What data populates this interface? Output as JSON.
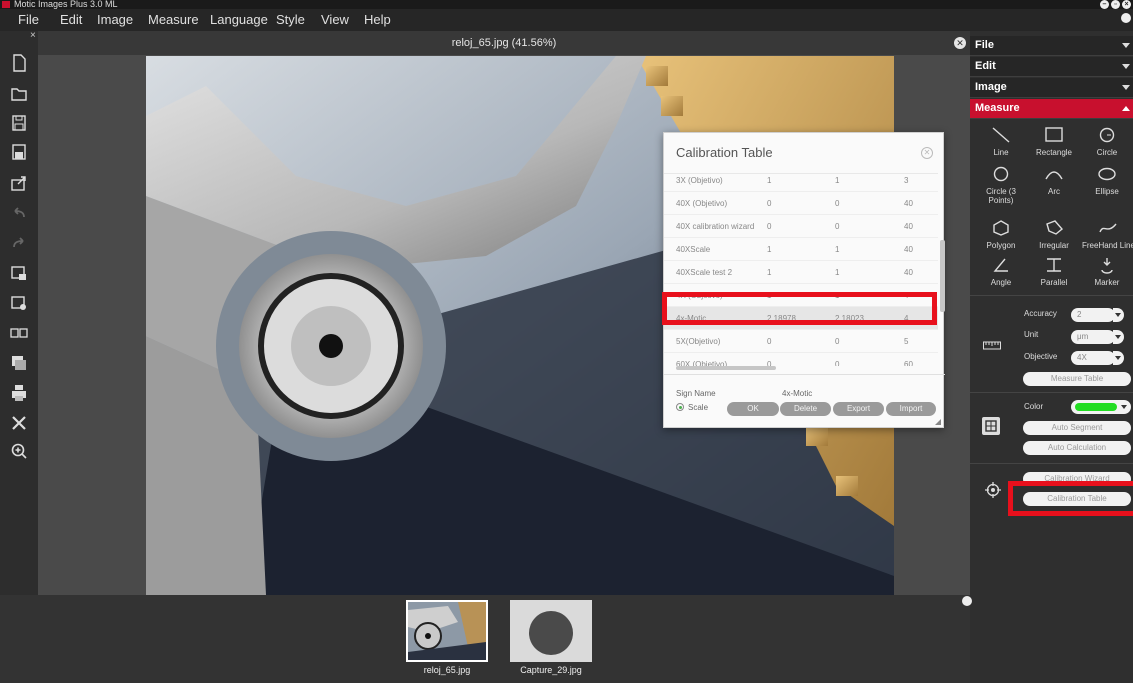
{
  "app": {
    "title": "Motic Images Plus 3.0 ML"
  },
  "menu": {
    "items": [
      "File",
      "Edit",
      "Image",
      "Measure",
      "Language",
      "Style",
      "View",
      "Help"
    ]
  },
  "toolbar": {
    "close_glyph": "×",
    "buttons": [
      "new-file-icon",
      "open-folder-icon",
      "save-icon",
      "save-as-icon",
      "export-icon",
      "undo-icon",
      "redo-icon",
      "slideshow-icon",
      "capture-icon",
      "compare-icon",
      "layers-icon",
      "print-icon",
      "tools-icon",
      "zoom-in-icon"
    ]
  },
  "canvas": {
    "title": "reloj_65.jpg (41.56%)",
    "close_glyph": "✕"
  },
  "dialog": {
    "title": "Calibration Table",
    "close_glyph": "✕",
    "rows": [
      {
        "name": "3X (Objetivo)",
        "a": "1",
        "b": "1",
        "c": "3"
      },
      {
        "name": "40X (Objetivo)",
        "a": "0",
        "b": "0",
        "c": "40"
      },
      {
        "name": "40X calibration wizard",
        "a": "0",
        "b": "0",
        "c": "40"
      },
      {
        "name": "40XScale",
        "a": "1",
        "b": "1",
        "c": "40"
      },
      {
        "name": "40XScale test 2",
        "a": "1",
        "b": "1",
        "c": "40"
      },
      {
        "name": "4X (Objetivo)",
        "a": "1",
        "b": "1",
        "c": "4"
      },
      {
        "name": "4x-Motic",
        "a": "2.18978",
        "b": "2.18023",
        "c": "4"
      },
      {
        "name": "5X(Objetivo)",
        "a": "0",
        "b": "0",
        "c": "5"
      },
      {
        "name": "60X (Objetivo)",
        "a": "0",
        "b": "0",
        "c": "60"
      }
    ],
    "selected_row": 6,
    "footer": {
      "sign_name_label": "Sign Name",
      "sign_name_value": "4x-Motic",
      "scale_label": "Scale",
      "buttons": {
        "ok": "OK",
        "delete": "Delete",
        "export": "Export",
        "import": "Import"
      }
    }
  },
  "right_panel": {
    "sections": {
      "file": "File",
      "edit": "Edit",
      "image": "Image",
      "measure": "Measure"
    },
    "tools": [
      {
        "label": "Line",
        "icon": "line-icon"
      },
      {
        "label": "Rectangle",
        "icon": "rectangle-icon"
      },
      {
        "label": "Circle",
        "icon": "circle-icon"
      },
      {
        "label": "Circle (3 Points)",
        "icon": "circle-3pt-icon"
      },
      {
        "label": "Arc",
        "icon": "arc-icon"
      },
      {
        "label": "Ellipse",
        "icon": "ellipse-icon"
      },
      {
        "label": "Polygon",
        "icon": "polygon-icon"
      },
      {
        "label": "Irregular",
        "icon": "irregular-icon"
      },
      {
        "label": "FreeHand Line",
        "icon": "freehand-icon"
      },
      {
        "label": "Angle",
        "icon": "angle-icon"
      },
      {
        "label": "Parallel",
        "icon": "parallel-icon"
      },
      {
        "label": "Marker",
        "icon": "marker-icon"
      }
    ],
    "accuracy_label": "Accuracy",
    "accuracy_value": "2",
    "unit_label": "Unit",
    "unit_value": "μm",
    "objective_label": "Objective",
    "objective_value": "4X",
    "measure_table_button": "Measure Table",
    "color_label": "Color",
    "color_value": "#22dd22",
    "auto_segment_button": "Auto Segment",
    "auto_calc_button": "Auto Calculation",
    "calib_wizard_button": "Calibration Wizard",
    "calib_table_button": "Calibration Table"
  },
  "thumbnails": [
    {
      "caption": "reloj_65.jpg",
      "selected": true
    },
    {
      "caption": "Capture_29.jpg",
      "selected": false
    }
  ],
  "colors": {
    "accent": "#c8102e",
    "highlight": "#e8101c"
  }
}
